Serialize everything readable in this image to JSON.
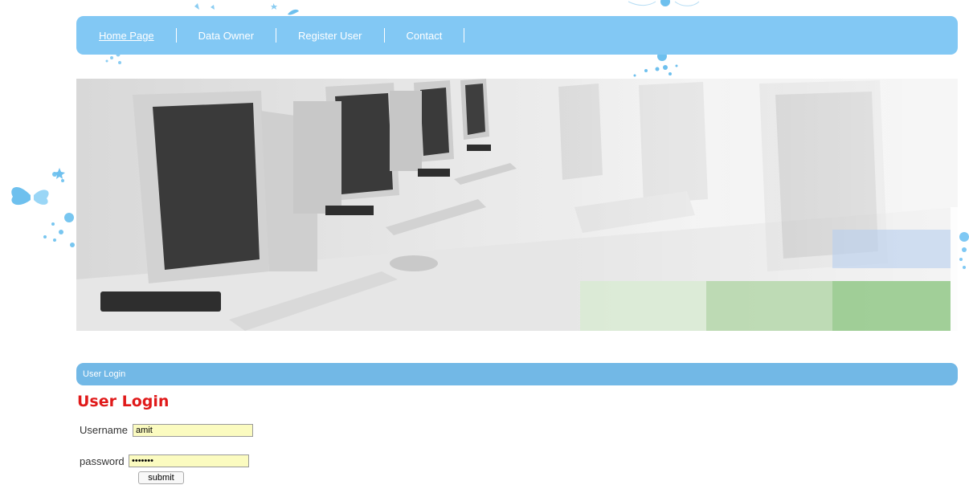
{
  "nav": {
    "items": [
      {
        "label": "Home Page",
        "active": true
      },
      {
        "label": "Data Owner",
        "active": false
      },
      {
        "label": "Register User",
        "active": false
      },
      {
        "label": "Contact",
        "active": false
      }
    ]
  },
  "banner": {
    "slides_total": 3,
    "active_slide": 3
  },
  "section": {
    "title": "User Login"
  },
  "login": {
    "heading": "User Login",
    "username_label": "Username",
    "username_value": "amit",
    "password_label": "password",
    "password_value": "amit123",
    "submit_label": "submit"
  },
  "colors": {
    "nav_bg": "#82c8f4",
    "section_bar": "#72b8e6",
    "heading_red": "#e01a1a",
    "input_bg": "#fbfbc0",
    "dot_active": "#7ec8f4",
    "dot_inactive": "#b9b9b9"
  },
  "icons": [
    "butterfly-icon",
    "star-icon",
    "bubble-dots-icon"
  ]
}
